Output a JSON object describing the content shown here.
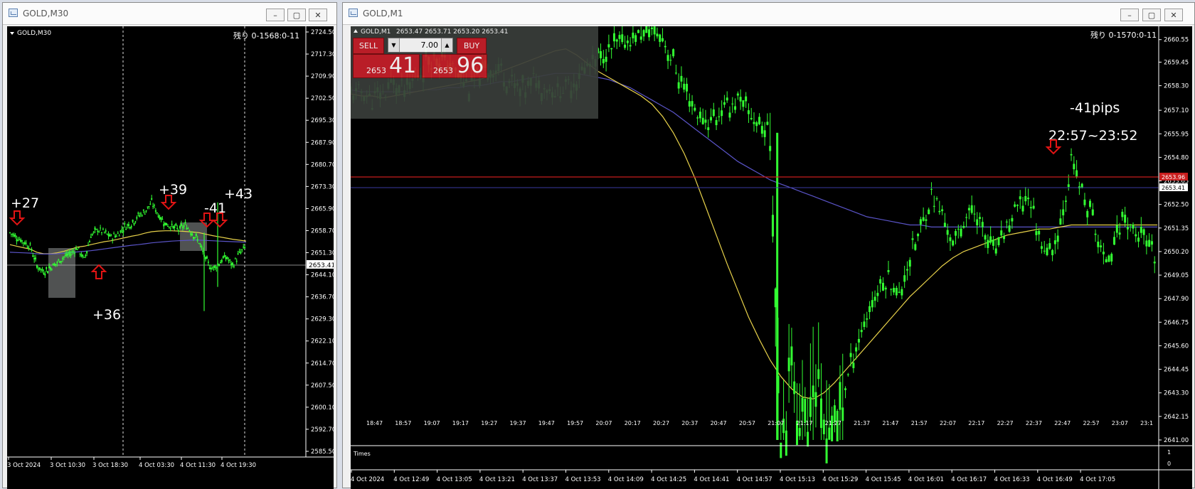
{
  "left_window": {
    "title": "GOLD,M30",
    "symbol_label": "GOLD,M30",
    "timer": "残り 0-1568:0-11",
    "current_price": "2653.41",
    "y_ticks": [
      "2724.50",
      "2717.30",
      "2709.90",
      "2702.50",
      "2695.30",
      "2687.90",
      "2680.70",
      "2673.30",
      "2665.90",
      "2658.70",
      "2651.30",
      "2644.10",
      "2636.70",
      "2629.30",
      "2622.10",
      "2614.70",
      "2607.50",
      "2600.10",
      "2592.70",
      "2585.50"
    ],
    "x_labels": [
      "3 Oct 2024",
      "3 Oct 10:30",
      "3 Oct 18:30",
      "4 Oct 03:30",
      "4 Oct 11:30",
      "4 Oct 19:30"
    ],
    "annotations": [
      "+27",
      "+36",
      "+39",
      "-41",
      "+43"
    ]
  },
  "right_window": {
    "title": "GOLD,M1",
    "symbol_label": "GOLD,M1",
    "ohlc": "2653.47 2653.71 2653.20 2653.41",
    "timer": "残り 0-1570:0-11",
    "sell_label": "SELL",
    "buy_label": "BUY",
    "lot_value": "7.00",
    "sell_price_small": "2653",
    "sell_price_big": "41",
    "buy_price_small": "2653",
    "buy_price_big": "96",
    "red_line_price": "2653.96",
    "current_price": "2653.41",
    "y_ticks": [
      "2660.55",
      "2659.45",
      "2658.30",
      "2657.10",
      "2655.95",
      "2654.80",
      "2653.65",
      "2652.50",
      "2651.35",
      "2650.20",
      "2649.05",
      "2647.90",
      "2646.75",
      "2645.60",
      "2644.45",
      "2643.30",
      "2642.15",
      "2641.00"
    ],
    "sub_x_labels": [
      "18:47",
      "18:57",
      "19:07",
      "19:17",
      "19:27",
      "19:37",
      "19:47",
      "19:57",
      "20:07",
      "20:17",
      "20:27",
      "20:37",
      "20:47",
      "20:57",
      "21:07",
      "21:17",
      "21:27",
      "21:37",
      "21:47",
      "21:57",
      "22:07",
      "22:17",
      "22:27",
      "22:37",
      "22:47",
      "22:57",
      "23:07",
      "23:1"
    ],
    "sub_panel_label": "Times",
    "sub_y_ticks": [
      "1",
      "0"
    ],
    "x_labels": [
      "4 Oct 2024",
      "4 Oct 12:49",
      "4 Oct 13:05",
      "4 Oct 13:21",
      "4 Oct 13:37",
      "4 Oct 13:53",
      "4 Oct 14:09",
      "4 Oct 14:25",
      "4 Oct 14:41",
      "4 Oct 14:57",
      "4 Oct 15:13",
      "4 Oct 15:29",
      "4 Oct 15:45",
      "4 Oct 16:01",
      "4 Oct 16:17",
      "4 Oct 16:33",
      "4 Oct 16:49",
      "4 Oct 17:05"
    ],
    "annotation_pips": "-41pips",
    "annotation_time": "22:57~23:52"
  },
  "window_buttons": {
    "minimize": "–",
    "maximize": "▢",
    "close": "✕"
  },
  "colors": {
    "candle": "#32ff32",
    "ma_fast": "#e8d24a",
    "ma_slow": "#5a54c8",
    "red_line": "#c81e1e",
    "arrow": "#e01414",
    "price_label_bg": "#ffffff",
    "red_label_bg": "#c81e1e"
  },
  "chart_data": [
    {
      "type": "line",
      "name": "GOLD,M30",
      "ylim": [
        2585.5,
        2724.5
      ],
      "x_labels": [
        "3 Oct 2024",
        "3 Oct 10:30",
        "3 Oct 18:30",
        "4 Oct 03:30",
        "4 Oct 11:30",
        "4 Oct 19:30"
      ],
      "series": [
        {
          "values": [
            2658.0,
            2656.5,
            2655.0,
            2653.5,
            2647.0,
            2645.0,
            2646.5,
            2648.0,
            2650.0,
            2651.0,
            2653.0,
            2649.0,
            2657.0,
            2659.0,
            2658.0,
            2656.5,
            2657.5,
            2660.0,
            2661.0,
            2663.5,
            2665.0,
            2668.0,
            2664.0,
            2661.0,
            2660.0,
            2659.0,
            2660.5,
            2658.0,
            2655.0,
            2649.0,
            2646.0,
            2648.0,
            2650.0,
            2647.0,
            2651.0,
            2653.41
          ]
        },
        {
          "values": [
            2654.0,
            2653.5,
            2653.0,
            2652.5,
            2651.5,
            2651.0,
            2651.0,
            2651.3,
            2651.8,
            2652.5,
            2653.2,
            2653.5,
            2654.0,
            2654.5,
            2655.0,
            2655.3,
            2655.8,
            2656.3,
            2656.8,
            2657.2,
            2657.8,
            2658.3,
            2658.5,
            2658.6,
            2658.6,
            2658.5,
            2658.4,
            2658.2,
            2658.0,
            2657.5,
            2657.0,
            2656.6,
            2656.2,
            2655.8,
            2655.5,
            2655.2
          ]
        },
        {
          "values": [
            2651.5,
            2651.4,
            2651.3,
            2651.2,
            2651.0,
            2650.9,
            2650.9,
            2651.0,
            2651.2,
            2651.4,
            2651.6,
            2651.8,
            2652.0,
            2652.3,
            2652.6,
            2652.9,
            2653.2,
            2653.5,
            2653.8,
            2654.0,
            2654.3,
            2654.6,
            2654.8,
            2655.0,
            2655.2,
            2655.3,
            2655.4,
            2655.5,
            2655.5,
            2655.4,
            2655.3,
            2655.2,
            2655.1,
            2655.0,
            2654.9,
            2654.8
          ]
        }
      ]
    },
    {
      "type": "line",
      "name": "GOLD,M1",
      "ylim": [
        2641.0,
        2661.2
      ],
      "x_labels": [
        "18:47",
        "18:57",
        "19:07",
        "19:17",
        "19:27",
        "19:37",
        "19:47",
        "19:57",
        "20:07",
        "20:17",
        "20:27",
        "20:37",
        "20:47",
        "20:57",
        "21:07",
        "21:17",
        "21:27",
        "21:37",
        "21:47",
        "21:57",
        "22:07",
        "22:17",
        "22:27",
        "22:37",
        "22:47",
        "22:57",
        "23:07",
        "23:1"
      ],
      "series": [
        {
          "values": [
            2657.8,
            2658.0,
            2657.6,
            2657.9,
            2658.4,
            2658.1,
            2658.6,
            2659.4,
            2659.8,
            2659.3,
            2658.9,
            2658.2,
            2658.7,
            2659.2,
            2659.0,
            2658.4,
            2658.0,
            2658.6,
            2658.3,
            2658.0,
            2658.2,
            2658.7,
            2659.2,
            2659.6,
            2660.0,
            2660.3,
            2660.6,
            2660.8,
            2661.0,
            2660.7,
            2659.4,
            2658.1,
            2657.1,
            2656.5,
            2656.8,
            2657.3,
            2657.6,
            2657.0,
            2656.4,
            2656.0,
            2641.3,
            2644.6,
            2641.5,
            2643.8,
            2641.2,
            2641.4,
            2643.6,
            2645.7,
            2647.0,
            2648.3,
            2649.0,
            2648.0,
            2650.0,
            2651.3,
            2653.0,
            2652.0,
            2650.5,
            2651.8,
            2652.2,
            2651.0,
            2650.2,
            2651.4,
            2652.3,
            2653.0,
            2651.0,
            2650.0,
            2651.5,
            2654.6,
            2653.0,
            2651.8,
            2649.7,
            2650.8,
            2652.0,
            2651.0,
            2650.6,
            2649.6
          ]
        },
        {
          "values": [
            2657.9,
            2657.8,
            2657.8,
            2657.7,
            2657.8,
            2657.9,
            2658.0,
            2658.1,
            2658.2,
            2658.3,
            2658.4,
            2658.5,
            2658.6,
            2658.8,
            2659.0,
            2659.2,
            2659.4,
            2659.6,
            2659.8,
            2660.0,
            2660.1,
            2659.8,
            2659.4,
            2659.0,
            2658.7,
            2658.4,
            2658.1,
            2657.8,
            2657.4,
            2656.8,
            2656.0,
            2655.0,
            2653.8,
            2652.4,
            2651.0,
            2649.6,
            2648.3,
            2647.0,
            2645.9,
            2644.9,
            2644.1,
            2643.5,
            2643.1,
            2643.0,
            2643.3,
            2643.8,
            2644.4,
            2645.0,
            2645.6,
            2646.2,
            2646.8,
            2647.4,
            2648.0,
            2648.5,
            2649.0,
            2649.5,
            2649.9,
            2650.2,
            2650.4,
            2650.6,
            2650.8,
            2651.0,
            2651.1,
            2651.2,
            2651.3,
            2651.3,
            2651.4,
            2651.5,
            2651.5,
            2651.5,
            2651.5,
            2651.5,
            2651.5,
            2651.5,
            2651.5,
            2651.5
          ]
        },
        {
          "values": [
            2658.1,
            2658.0,
            2658.0,
            2658.0,
            2658.0,
            2658.0,
            2658.0,
            2658.1,
            2658.1,
            2658.2,
            2658.2,
            2658.3,
            2658.3,
            2658.4,
            2658.5,
            2658.5,
            2658.6,
            2658.7,
            2658.8,
            2658.9,
            2658.9,
            2658.9,
            2658.8,
            2658.7,
            2658.6,
            2658.4,
            2658.2,
            2657.9,
            2657.6,
            2657.3,
            2657.0,
            2656.6,
            2656.2,
            2655.8,
            2655.4,
            2655.0,
            2654.6,
            2654.3,
            2654.0,
            2653.7,
            2653.5,
            2653.3,
            2653.1,
            2652.9,
            2652.7,
            2652.5,
            2652.3,
            2652.1,
            2651.9,
            2651.8,
            2651.7,
            2651.6,
            2651.5,
            2651.5,
            2651.4,
            2651.4,
            2651.4,
            2651.4,
            2651.4,
            2651.4,
            2651.4,
            2651.4,
            2651.4,
            2651.4,
            2651.4,
            2651.4,
            2651.4,
            2651.4,
            2651.4,
            2651.4,
            2651.4,
            2651.4,
            2651.4,
            2651.4,
            2651.4,
            2651.4
          ]
        }
      ]
    }
  ]
}
